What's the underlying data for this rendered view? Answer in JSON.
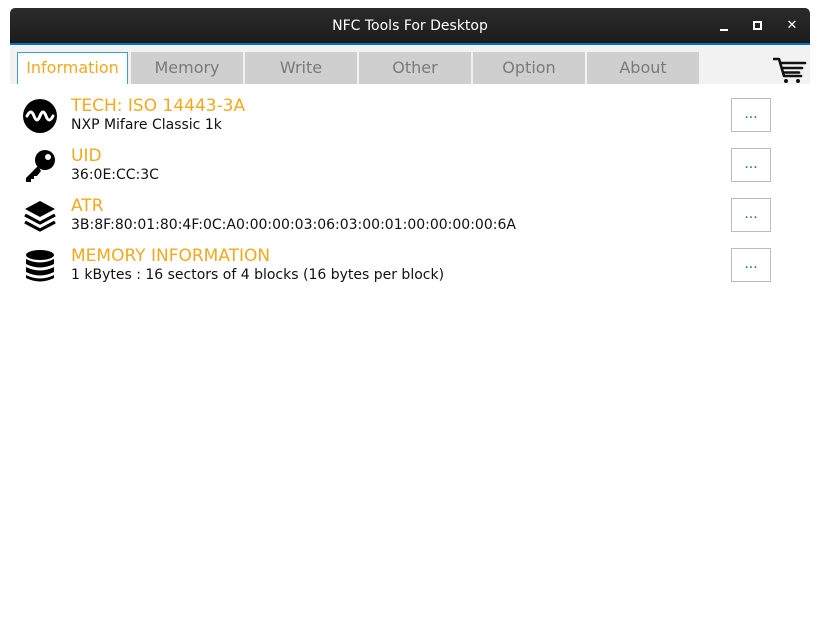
{
  "window": {
    "title": "NFC Tools For Desktop",
    "controls": {
      "minimize": "_",
      "maximize": "□",
      "close": "✕"
    }
  },
  "tabs": [
    {
      "label": "Information",
      "active": true
    },
    {
      "label": "Memory",
      "active": false
    },
    {
      "label": "Write",
      "active": false
    },
    {
      "label": "Other",
      "active": false
    },
    {
      "label": "Option",
      "active": false
    },
    {
      "label": "About",
      "active": false
    }
  ],
  "toolbar": {
    "cart_icon": "cart-icon"
  },
  "info_rows": [
    {
      "icon": "waveform-icon",
      "label": "TECH: ISO 14443-3A",
      "value": "NXP Mifare Classic 1k",
      "button": "..."
    },
    {
      "icon": "key-icon",
      "label": "UID",
      "value": "36:0E:CC:3C",
      "button": "..."
    },
    {
      "icon": "layers-icon",
      "label": "ATR",
      "value": "3B:8F:80:01:80:4F:0C:A0:00:00:03:06:03:00:01:00:00:00:00:6A",
      "button": "..."
    },
    {
      "icon": "database-icon",
      "label": "MEMORY INFORMATION",
      "value": "1 kBytes : 16 sectors of 4 blocks (16 bytes per block)",
      "button": "..."
    }
  ],
  "colors": {
    "accent": "#f2a91d",
    "titlebar": "#1c1c1c",
    "tab_inactive": "#cfcfcf",
    "active_tab_border": "#3aa0d8",
    "button_text": "#1b8a2a"
  }
}
